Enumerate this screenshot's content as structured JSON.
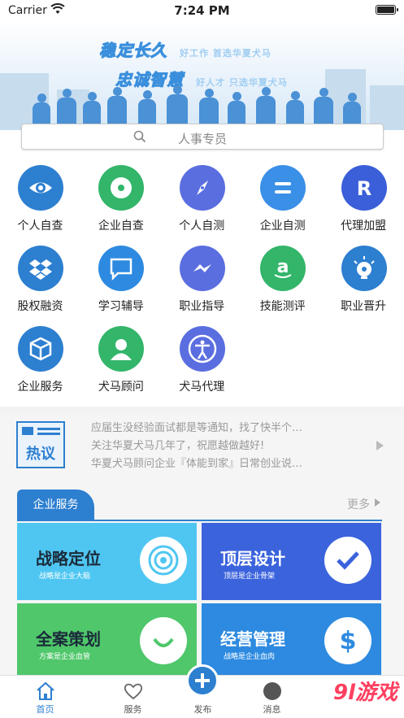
{
  "status_bar": {
    "carrier": "Carrier",
    "time": "7:24 PM"
  },
  "banner": {
    "line1_big": "稳定长久",
    "line1_small": "好工作   首选华夏犬马",
    "line2_big": "忠诚智慧",
    "line2_small": "好人才   只选华夏犬马"
  },
  "search": {
    "placeholder": "人事专员"
  },
  "grid": [
    {
      "label": "个人自查",
      "icon": "eye-icon",
      "color": "#2d7fd0"
    },
    {
      "label": "企业自查",
      "icon": "disc-icon",
      "color": "#33b56a"
    },
    {
      "label": "个人自测",
      "icon": "compass-icon",
      "color": "#5a6ee0"
    },
    {
      "label": "企业自测",
      "icon": "equals-icon",
      "color": "#3a8fe6"
    },
    {
      "label": "代理加盟",
      "icon": "r-letter-icon",
      "color": "#3b5fd8"
    },
    {
      "label": "股权融资",
      "icon": "dropbox-icon",
      "color": "#2d7fd0"
    },
    {
      "label": "学习辅导",
      "icon": "chat-bubble-icon",
      "color": "#2d8ae0"
    },
    {
      "label": "职业指导",
      "icon": "messenger-bolt-icon",
      "color": "#5a6ee0"
    },
    {
      "label": "技能测评",
      "icon": "amazon-icon",
      "color": "#33b56a"
    },
    {
      "label": "职业晋升",
      "icon": "lightbulb-icon",
      "color": "#2d7fd0"
    },
    {
      "label": "企业服务",
      "icon": "box-3d-icon",
      "color": "#2d7fd0"
    },
    {
      "label": "犬马顾问",
      "icon": "user-icon",
      "color": "#33b56a"
    },
    {
      "label": "犬马代理",
      "icon": "accessibility-icon",
      "color": "#5a6ee0"
    }
  ],
  "news": {
    "badge": "热议",
    "items": [
      "应届生没经验面试都是等通知，找了快半个…",
      "关注华夏犬马几年了，祝愿越做越好!",
      "华夏犬马顾问企业『体能到家』日常创业说…"
    ]
  },
  "section": {
    "tab_label": "企业服务",
    "more_label": "更多",
    "cards": [
      {
        "title": "战略定位",
        "subtitle": "战略是企业大脑",
        "color": "#4fc6f2",
        "icon": "target-icon"
      },
      {
        "title": "顶层设计",
        "subtitle": "顶层是企业骨架",
        "color": "#3b63dc",
        "icon": "check-icon"
      },
      {
        "title": "全案策划",
        "subtitle": "方案是企业血管",
        "color": "#4fc76a",
        "icon": "smile-icon"
      },
      {
        "title": "经营管理",
        "subtitle": "战略是企业血肉",
        "color": "#2d8ae0",
        "icon": "dollar-icon"
      }
    ]
  },
  "tabbar": {
    "items": [
      {
        "label": "首页",
        "icon": "home-icon"
      },
      {
        "label": "服务",
        "icon": "heart-icon"
      },
      {
        "label": "发布",
        "icon": "plus-icon"
      },
      {
        "label": "消息",
        "icon": "message-icon"
      }
    ]
  },
  "watermark": "9l游戏"
}
